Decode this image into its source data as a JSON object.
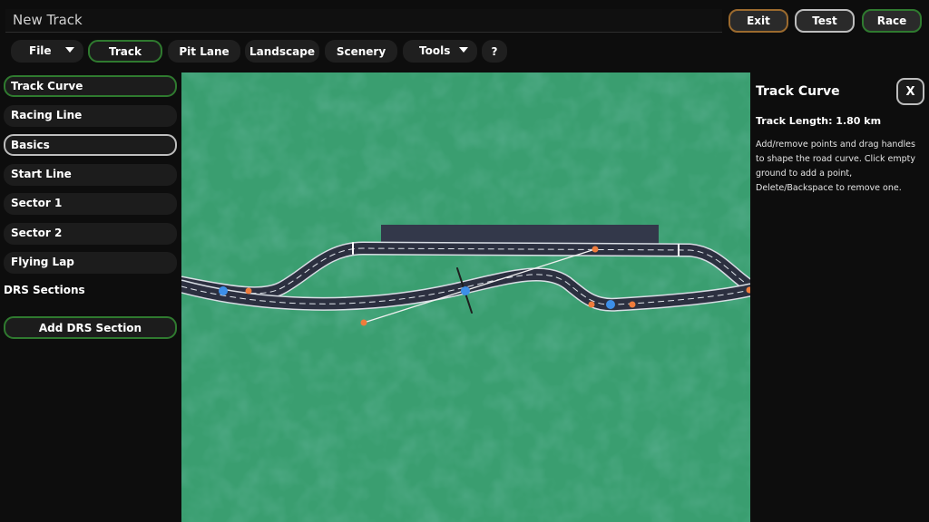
{
  "header": {
    "track_name": "New Track",
    "exit_label": "Exit",
    "test_label": "Test",
    "race_label": "Race"
  },
  "menu": {
    "file": "File",
    "track": "Track",
    "pit_lane": "Pit Lane",
    "landscape": "Landscape",
    "scenery": "Scenery",
    "tools": "Tools",
    "help": "?"
  },
  "sidebar": {
    "items": [
      "Track Curve",
      "Racing Line",
      "Basics",
      "Start Line",
      "Sector 1",
      "Sector 2",
      "Flying Lap"
    ],
    "drs_heading": "DRS Sections",
    "add_drs": "Add DRS Section"
  },
  "panel": {
    "title": "Track Curve",
    "close": "X",
    "track_length": "Track Length: 1.80 km",
    "help_text": "Add/remove points and drag handles to shape the road curve. Click empty ground to add a point, Delete/Backspace to remove one."
  },
  "colors": {
    "grass": "#3a9e70",
    "road": "#2c3040",
    "accent_green": "#2f7a2f",
    "exit_border": "#9b6a2e",
    "control_point": "#3d8fe8",
    "handle": "#ef7c3c"
  }
}
